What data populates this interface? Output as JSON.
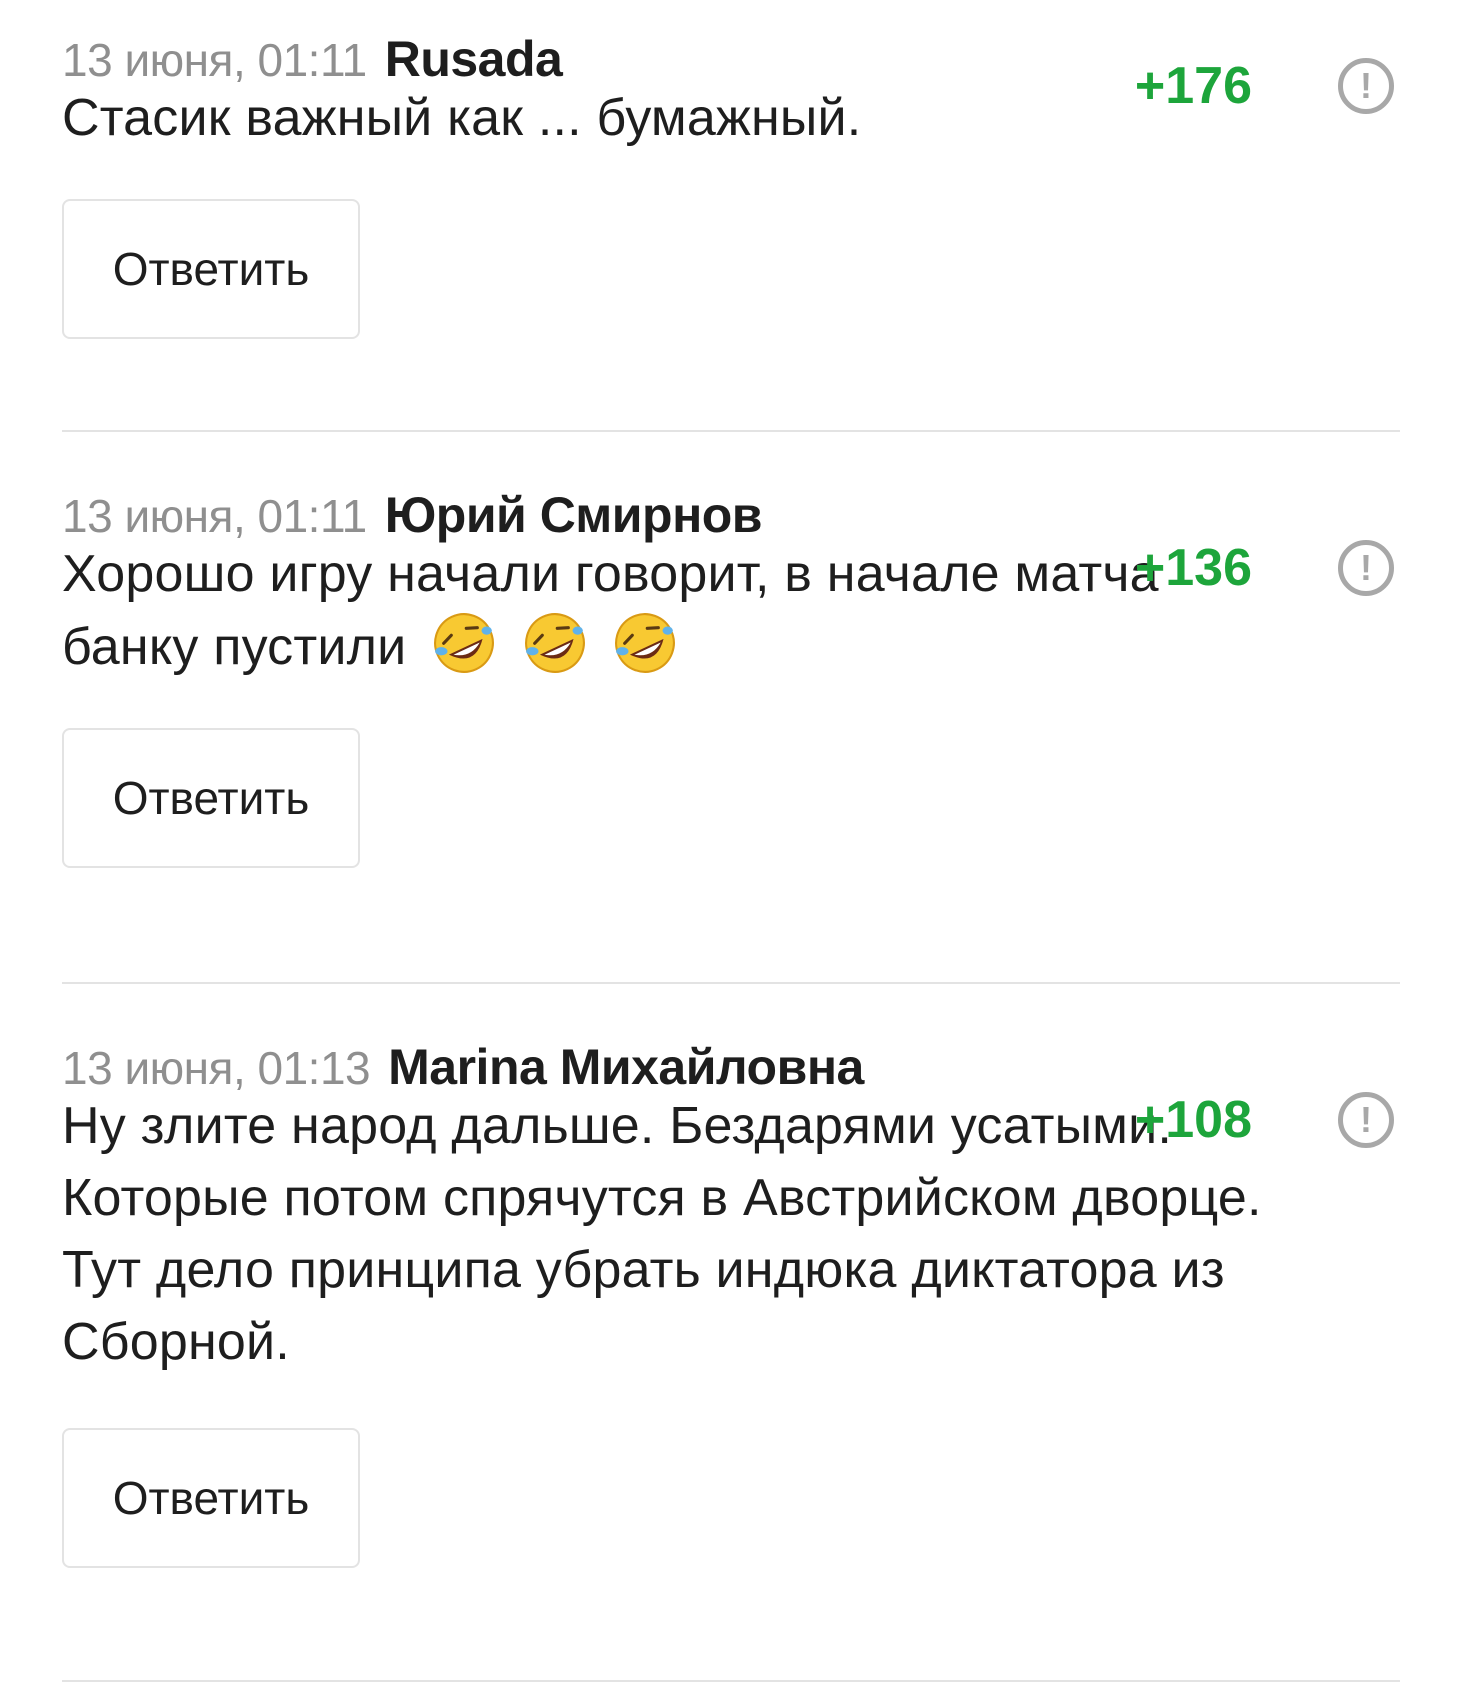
{
  "colors": {
    "score": "#1da53b",
    "meta": "#8f8f8f",
    "text": "#1e1e1e",
    "divider": "#e3e3e3",
    "report_icon": "#a8a8a8"
  },
  "comments": [
    {
      "time": "13 июня, 01:11",
      "author": "Rusada",
      "score": "+176",
      "report_icon": "!",
      "text": "Стасик важный как ... бумажный.",
      "reply_label": "Ответить"
    },
    {
      "time": "13 июня, 01:11",
      "author": "Юрий Смирнов",
      "score": "+136",
      "report_icon": "!",
      "text_line1": "Хорошо игру начали говорит, в начале матча",
      "text_line2": "банку пустили",
      "emoji": [
        "rolling-on-floor-laughing",
        "rolling-on-floor-laughing",
        "rolling-on-floor-laughing"
      ],
      "reply_label": "Ответить"
    },
    {
      "time": "13 июня, 01:13",
      "author": "Marina Михайловна",
      "score": "+108",
      "report_icon": "!",
      "text_lines": [
        "Ну злите народ дальше. Бездарями усатыми.",
        "Которые потом спрячутся в Австрийском дворце.",
        "Тут дело принципа убрать индюка диктатора из",
        "Сборной."
      ],
      "reply_label": "Ответить"
    }
  ]
}
